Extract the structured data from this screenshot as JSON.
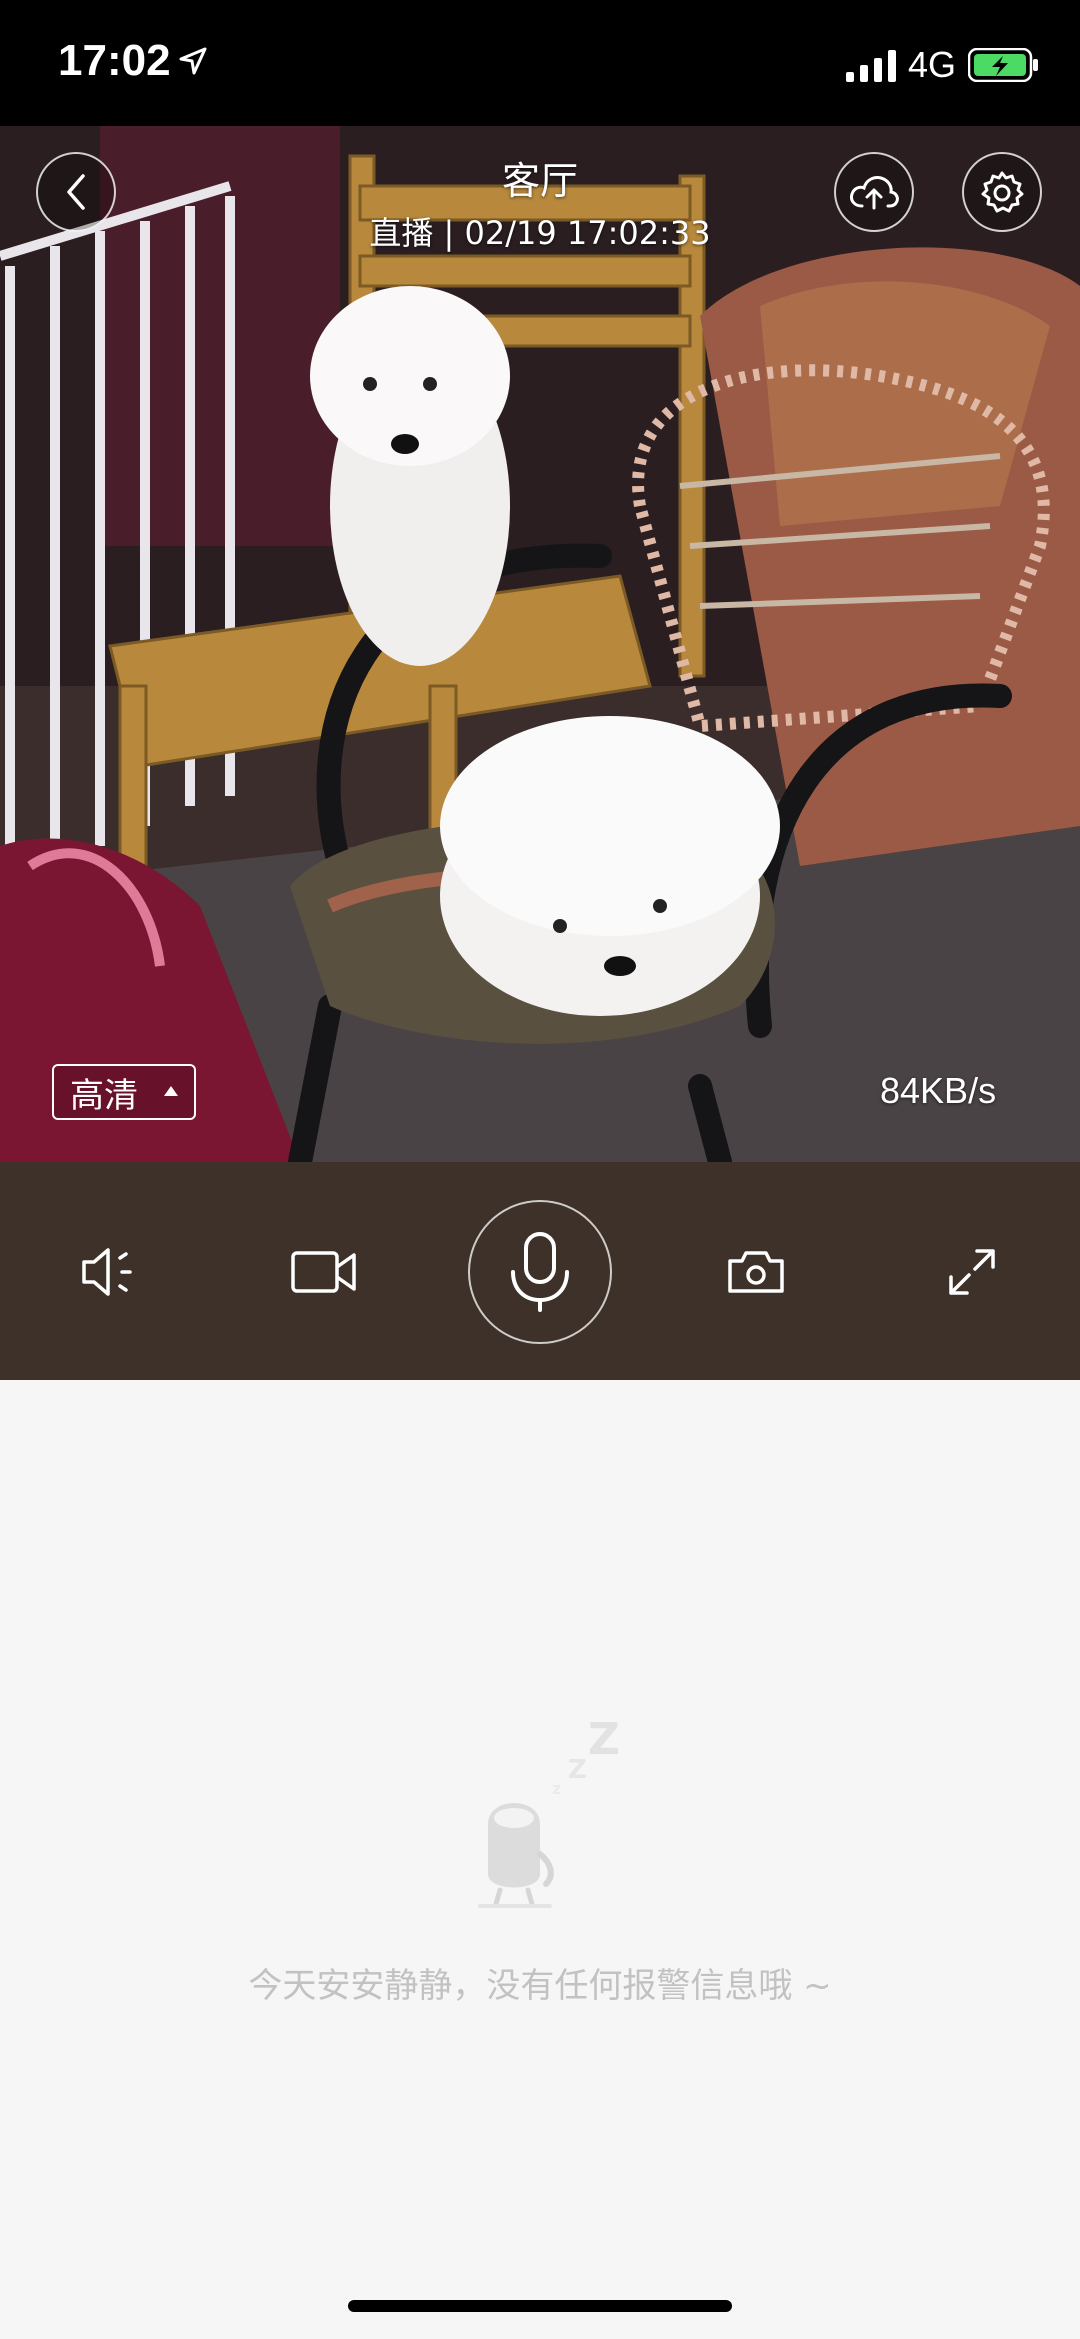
{
  "status_bar": {
    "time": "17:02",
    "network": "4G",
    "icons": [
      "location-arrow-icon",
      "signal-bars-icon",
      "battery-charging-icon"
    ]
  },
  "video": {
    "title": "客厅",
    "live_status": "直播 | 02/19 17:02:33",
    "quality": "高清",
    "bitrate": "84KB/s",
    "icons": [
      "back-icon",
      "cloud-upload-icon",
      "gear-icon",
      "caret-up-icon"
    ]
  },
  "controls": {
    "icons": [
      "speaker-icon",
      "video-record-icon",
      "microphone-icon",
      "camera-icon",
      "fullscreen-icon"
    ],
    "bar_color": "#3d3129"
  },
  "alerts": {
    "empty_message": "今天安安静静，没有任何报警信息哦 ~",
    "illustration": "sleeping-robot-icon"
  }
}
